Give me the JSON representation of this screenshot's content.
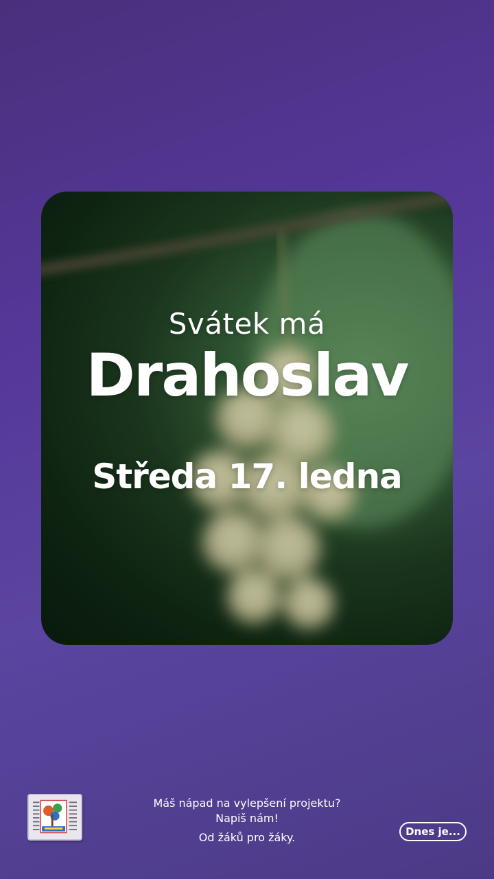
{
  "card": {
    "subtitle": "Svátek má",
    "name": "Drahoslav",
    "date": "Středa 17. ledna"
  },
  "footer": {
    "logo_icon": "school-newspaper-logo-icon",
    "line1": "Máš nápad na vylepšení projektu?",
    "line2": "Napiš nám!",
    "line3": "Od žáků  pro žáky."
  },
  "today_button": {
    "label": "Dnes je..."
  },
  "colors": {
    "background": "#55389a",
    "card_green": "#1e3d22",
    "text": "#ffffff"
  }
}
